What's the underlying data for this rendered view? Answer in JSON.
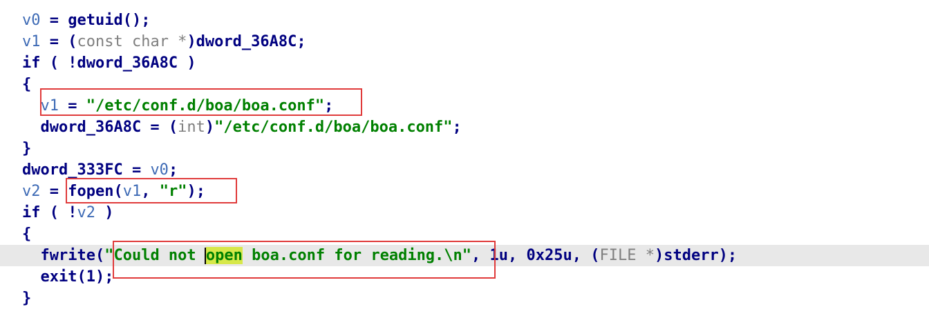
{
  "lines": [
    {
      "parts": [
        "v0",
        " = ",
        "getuid",
        "();"
      ]
    },
    {
      "parts": [
        "v1",
        " = (",
        "const char *",
        ")dword_36A8C;"
      ]
    },
    {
      "parts": [
        "if ( !dword_36A8C )"
      ]
    },
    {
      "parts": [
        "{"
      ]
    },
    {
      "parts": [
        "  ",
        "v1",
        " = ",
        "\"/etc/conf.d/boa/boa.conf\"",
        ";"
      ]
    },
    {
      "parts": [
        "  dword_36A8C = (",
        "int",
        ")",
        "\"/etc/conf.d/boa/boa.conf\"",
        ";"
      ]
    },
    {
      "parts": [
        "}"
      ]
    },
    {
      "parts": [
        "dword_333FC = ",
        "v0",
        ";"
      ]
    },
    {
      "parts": [
        "v2",
        " = ",
        "fopen(",
        "v1",
        ", ",
        "\"r\"",
        ");"
      ]
    },
    {
      "parts": [
        "if ( !",
        "v2",
        " )"
      ]
    },
    {
      "parts": [
        "{"
      ]
    },
    {
      "parts": [
        "  fwrite(",
        "\"Could not ",
        "open",
        " boa.conf for reading.\\n\"",
        ", 1u, 0x25u, (",
        "FILE *",
        ")stderr);"
      ]
    },
    {
      "parts": [
        "  exit(1);"
      ]
    },
    {
      "parts": [
        "}"
      ]
    }
  ],
  "highlight": {
    "selected_word": "open"
  },
  "colors": {
    "keyword": "#000080",
    "variable": "#3d6ab5",
    "string": "#008000",
    "cast": "#7f7f7f",
    "annotation_box": "#e03a3a",
    "selection": "#d7e84a"
  }
}
